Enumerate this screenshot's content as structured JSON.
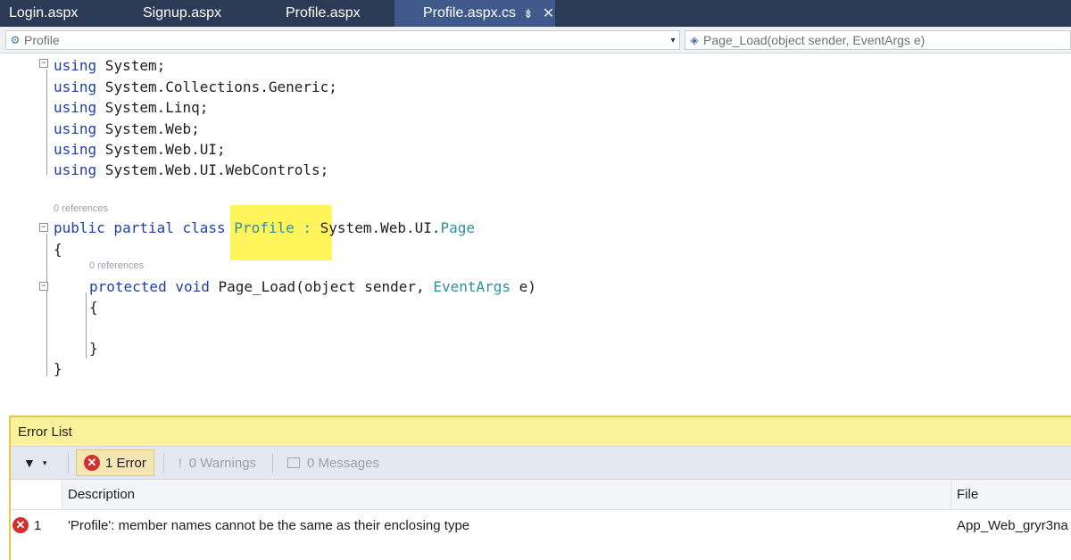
{
  "tabs": [
    {
      "label": "Login.aspx"
    },
    {
      "label": "Signup.aspx"
    },
    {
      "label": "Profile.aspx"
    },
    {
      "label": "Profile.aspx.cs",
      "active": true,
      "pin_glyph": "⇟",
      "close_glyph": "✕"
    }
  ],
  "navbar": {
    "class_selector": "Profile",
    "member_selector": "Page_Load(object sender, EventArgs e)"
  },
  "code": {
    "usings": [
      {
        "kw": "using",
        "ns": " System;"
      },
      {
        "kw": "using",
        "ns": " System.Collections.Generic;"
      },
      {
        "kw": "using",
        "ns": " System.Linq;"
      },
      {
        "kw": "using",
        "ns": " System.Web;"
      },
      {
        "kw": "using",
        "ns": " System.Web.UI;"
      },
      {
        "kw": "using",
        "ns": " System.Web.UI.WebControls;"
      }
    ],
    "refs_class": "0 references",
    "class_kw": "public partial class",
    "class_name": "Profile",
    "class_colon": ":",
    "base_ns": "System.Web.UI.",
    "base_type": "Page",
    "open_brace": "{",
    "refs_method": "0 references",
    "method_kw": "protected void",
    "method_name": " Page_Load(object sender, ",
    "method_param_type": "EventArgs",
    "method_param": " e)",
    "method_open": "{",
    "method_close": "}",
    "close_brace": "}"
  },
  "error_list": {
    "title": "Error List",
    "errors_btn": "1 Error",
    "warnings_btn": "0 Warnings",
    "messages_btn": "0 Messages",
    "col_description": "Description",
    "col_file": "File",
    "rows": [
      {
        "num": "1",
        "description": "'Profile': member names cannot be the same as their enclosing type",
        "file": "App_Web_gryr3na"
      }
    ]
  },
  "colors": {
    "tab_bg": "#2b3a55",
    "active_tab": "#3f5a8a",
    "keyword": "#1f3fa8",
    "type": "#2b8fa6",
    "highlight": "#fff45a",
    "error_red": "#d32f2f"
  }
}
